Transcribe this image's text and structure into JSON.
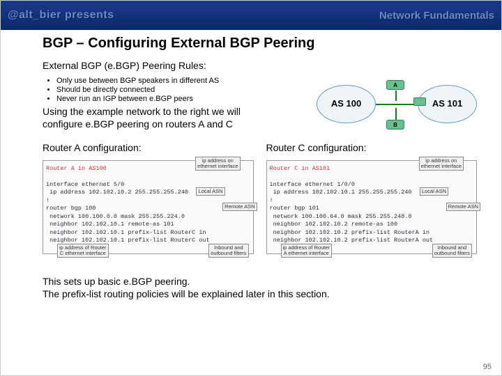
{
  "header": {
    "left": "@alt_bier presents",
    "right": "Network Fundamentals"
  },
  "title": "BGP – Configuring External BGP Peering",
  "subtitle": "External BGP (e.BGP) Peering Rules:",
  "bullets": [
    "Only use between BGP speakers in different AS",
    "Should be directly connected",
    "Never run an IGP between e.BGP peers"
  ],
  "exampleLine1": "Using the example network to the right we will",
  "exampleLine2": "configure e.BGP peering on routers A and C",
  "diagram": {
    "asLeft": "AS 100",
    "asRight": "AS 101",
    "routerA": "A",
    "routerB": "B"
  },
  "routerA": {
    "title": "Router A configuration:",
    "cfgTitle": "Router A in AS100",
    "line1": "interface ethernet 5/0",
    "line2": " ip address 102.102.10.2 255.255.255.240",
    "line3": "!",
    "line4": "router bgp 100",
    "line5": " network 100.100.0.0 mask 255.255.224.0",
    "line6": " neighbor 102.102.10.1 remote-as 101",
    "line7": " neighbor 102.102.10.1 prefix-list RouterC in",
    "line8": " neighbor 102.102.10.1 prefix-list RouterC out",
    "annotIp": "ip address on\nethernet interface",
    "annotLocal": "Local ASN",
    "annotRemote": "Remote ASN",
    "annotPeer": "ip address of Router\nC ethernet interface",
    "annotFilter": "Inbound and\noutbound filters"
  },
  "routerC": {
    "title": "Router C configuration:",
    "cfgTitle": "Router C in AS101",
    "line1": "interface ethernet 1/0/0",
    "line2": " ip address 102.102.10.1 255.255.255.240",
    "line3": "!",
    "line4": "router bgp 101",
    "line5": " network 100.100.64.0 mask 255.255.248.0",
    "line6": " neighbor 102.102.10.2 remote-as 100",
    "line7": " neighbor 102.102.10.2 prefix-list RouterA in",
    "line8": " neighbor 102.102.10.2 prefix-list RouterA out",
    "annotIp": "ip address on\nethernet interface",
    "annotLocal": "Local ASN",
    "annotRemote": "Remote ASN",
    "annotPeer": "ip address of Router\nA ethernet interface",
    "annotFilter": "Inbound and\noutbound filters"
  },
  "summaryLine1": "This sets up basic e.BGP peering.",
  "summaryLine2": "The prefix-list routing policies will be explained later in this section.",
  "pageNum": "95"
}
